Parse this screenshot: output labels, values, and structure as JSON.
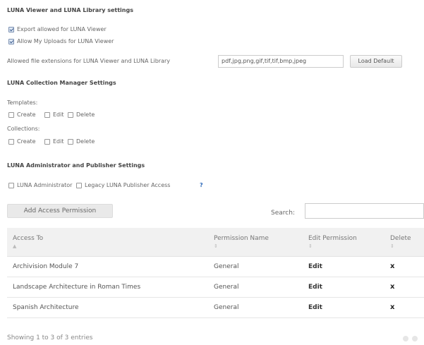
{
  "viewer": {
    "heading": "LUNA Viewer and LUNA Library settings",
    "export_label": "Export allowed for LUNA Viewer",
    "uploads_label": "Allow My Uploads for LUNA Viewer",
    "ext_label": "Allowed file extensions for LUNA Viewer and LUNA Library",
    "ext_value": "pdf,jpg,png,gif,tif,tif,bmp,jpeg",
    "load_default": "Load Default"
  },
  "collection_manager": {
    "heading": "LUNA Collection Manager Settings",
    "templates_label": "Templates:",
    "collections_label": "Collections:",
    "create": "Create",
    "edit": "Edit",
    "delete": "Delete"
  },
  "admin": {
    "heading": "LUNA Administrator and Publisher Settings",
    "admin_label": "LUNA Administrator",
    "legacy_label": "Legacy LUNA Publisher Access",
    "help": "?"
  },
  "permissions": {
    "add_button": "Add Access Permission",
    "search_label": "Search:",
    "search_placeholder": "",
    "columns": [
      "Access To",
      "Permission Name",
      "Edit Permission",
      "Delete"
    ],
    "rows": [
      {
        "access_to": "Archivision Module 7",
        "permission": "General",
        "edit": "Edit",
        "delete": "x"
      },
      {
        "access_to": "Landscape Architecture in Roman Times",
        "permission": "General",
        "edit": "Edit",
        "delete": "x"
      },
      {
        "access_to": "Spanish Architecture",
        "permission": "General",
        "edit": "Edit",
        "delete": "x"
      }
    ],
    "footer": "Showing 1 to 3 of 3 entries"
  }
}
